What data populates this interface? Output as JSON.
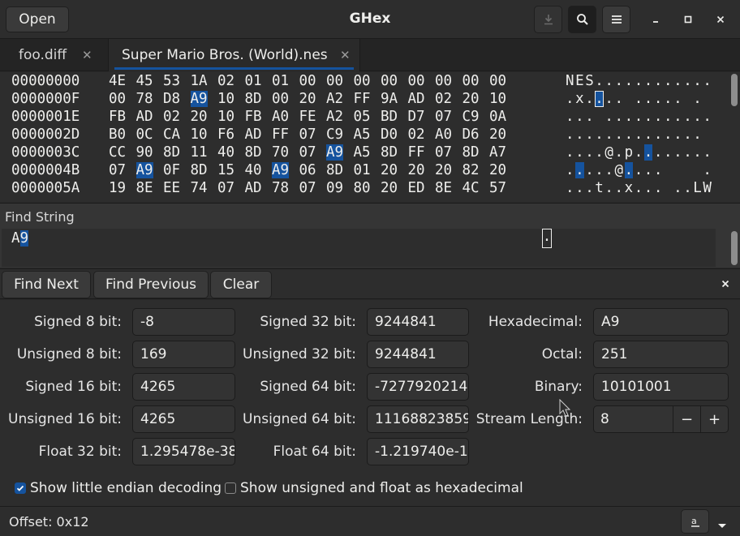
{
  "header": {
    "title": "GHex",
    "open_label": "Open"
  },
  "tabs": [
    {
      "label": "foo.diff"
    },
    {
      "label": "Super Mario Bros. (World).nes"
    }
  ],
  "hex": {
    "rows": [
      {
        "offset": "00000000",
        "bytes": [
          "4E",
          "45",
          "53",
          "1A",
          "02",
          "01",
          "01",
          "00",
          "00",
          "00",
          "00",
          "00",
          "00",
          "00",
          "00"
        ],
        "ascii": "NES............"
      },
      {
        "offset": "0000000F",
        "bytes": [
          "00",
          "78",
          "D8",
          "A9",
          "10",
          "8D",
          "00",
          "20",
          "A2",
          "FF",
          "9A",
          "AD",
          "02",
          "20",
          "10"
        ],
        "ascii": ".x.... ..... ."
      },
      {
        "offset": "0000001E",
        "bytes": [
          "FB",
          "AD",
          "02",
          "20",
          "10",
          "FB",
          "A0",
          "FE",
          "A2",
          "05",
          "BD",
          "D7",
          "07",
          "C9",
          "0A"
        ],
        "ascii": "... ..........."
      },
      {
        "offset": "0000002D",
        "bytes": [
          "B0",
          "0C",
          "CA",
          "10",
          "F6",
          "AD",
          "FF",
          "07",
          "C9",
          "A5",
          "D0",
          "02",
          "A0",
          "D6",
          "20"
        ],
        "ascii": ".............. "
      },
      {
        "offset": "0000003C",
        "bytes": [
          "CC",
          "90",
          "8D",
          "11",
          "40",
          "8D",
          "70",
          "07",
          "A9",
          "A5",
          "8D",
          "FF",
          "07",
          "8D",
          "A7"
        ],
        "ascii": "....@.p........"
      },
      {
        "offset": "0000004B",
        "bytes": [
          "07",
          "A9",
          "0F",
          "8D",
          "15",
          "40",
          "A9",
          "06",
          "8D",
          "01",
          "20",
          "20",
          "20",
          "82",
          "20"
        ],
        "ascii": ".....@....    ."
      },
      {
        "offset": "0000005A",
        "bytes": [
          "19",
          "8E",
          "EE",
          "74",
          "07",
          "AD",
          "78",
          "07",
          "09",
          "80",
          "20",
          "ED",
          "8E",
          "4C",
          "57"
        ],
        "ascii": "...t..x... ..LW"
      }
    ]
  },
  "find": {
    "label": "Find String",
    "text_a": "A",
    "text_b": "9",
    "caret_char": ".",
    "next_label": "Find Next",
    "prev_label": "Find Previous",
    "clear_label": "Clear"
  },
  "converter": {
    "signed8_label": "Signed 8 bit:",
    "signed8": "-8",
    "unsigned8_label": "Unsigned 8 bit:",
    "unsigned8": "169",
    "signed16_label": "Signed 16 bit:",
    "signed16": "4265",
    "unsigned16_label": "Unsigned 16 bit:",
    "unsigned16": "4265",
    "float32_label": "Float 32 bit:",
    "float32": "1.295478e-38",
    "signed32_label": "Signed 32 bit:",
    "signed32": "9244841",
    "unsigned32_label": "Unsigned 32 bit:",
    "unsigned32": "9244841",
    "signed64_label": "Signed 64 bit:",
    "signed64": "-7277920214",
    "unsigned64_label": "Unsigned 64 bit:",
    "unsigned64": "11168823859",
    "float64_label": "Float 64 bit:",
    "float64": "-1.219740e-1",
    "hex_label": "Hexadecimal:",
    "hex": "A9",
    "octal_label": "Octal:",
    "octal": "251",
    "binary_label": "Binary:",
    "binary": "10101001",
    "stream_label": "Stream Length:",
    "stream": "8",
    "little_endian_label": "Show little endian decoding",
    "little_endian_checked": true,
    "unsigned_hex_label": "Show unsigned and float as hexadecimal",
    "unsigned_hex_checked": false
  },
  "status": {
    "offset_text": "Offset: 0x12"
  },
  "colors": {
    "accent": "#15539e",
    "background": "#2d2d2d"
  }
}
